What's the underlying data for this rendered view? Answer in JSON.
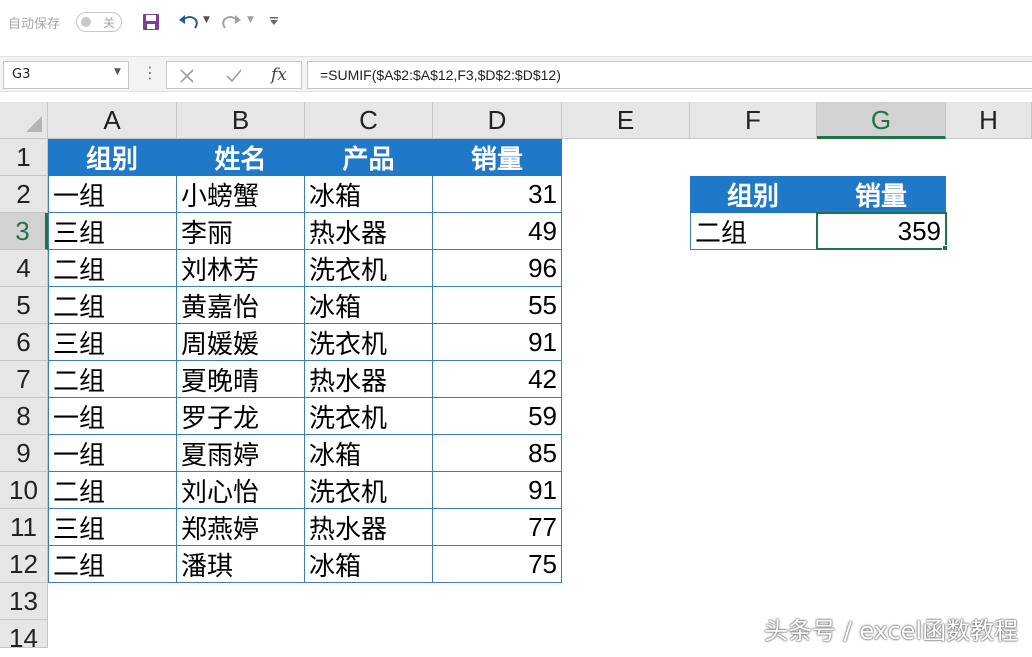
{
  "toolbar": {
    "autosave_label": "自动保存",
    "autosave_state": "关",
    "save_icon": "save-icon",
    "undo_icon": "undo-icon",
    "redo_icon": "redo-icon",
    "customize_icon": "customize-qat-icon"
  },
  "formula_bar": {
    "name_box": "G3",
    "formula": "=SUMIF($A$2:$A$12,F3,$D$2:$D$12)"
  },
  "sheet": {
    "columns": [
      "A",
      "B",
      "C",
      "D",
      "E",
      "F",
      "G",
      "H"
    ],
    "rows": [
      "1",
      "2",
      "3",
      "4",
      "5",
      "6",
      "7",
      "8",
      "9",
      "10",
      "11",
      "12",
      "13",
      "14"
    ],
    "active_cell": "G3",
    "active_column": "G",
    "active_row": "3",
    "table_headers": [
      "组别",
      "姓名",
      "产品",
      "销量"
    ],
    "table_rows": [
      [
        "一组",
        "小螃蟹",
        "冰箱",
        "31"
      ],
      [
        "三组",
        "李丽",
        "热水器",
        "49"
      ],
      [
        "二组",
        "刘林芳",
        "洗衣机",
        "96"
      ],
      [
        "二组",
        "黄嘉怡",
        "冰箱",
        "55"
      ],
      [
        "三组",
        "周媛媛",
        "洗衣机",
        "91"
      ],
      [
        "二组",
        "夏晚晴",
        "热水器",
        "42"
      ],
      [
        "一组",
        "罗子龙",
        "洗衣机",
        "59"
      ],
      [
        "一组",
        "夏雨婷",
        "冰箱",
        "85"
      ],
      [
        "二组",
        "刘心怡",
        "洗衣机",
        "91"
      ],
      [
        "三组",
        "郑燕婷",
        "热水器",
        "77"
      ],
      [
        "二组",
        "潘琪",
        "冰箱",
        "75"
      ]
    ],
    "lookup_headers": [
      "组别",
      "销量"
    ],
    "lookup_row": [
      "二组",
      "359"
    ]
  },
  "watermark": "头条号 / excel函数教程",
  "colors": {
    "header_fill": "#1f78c8",
    "border_blue": "#3d7db8",
    "selection_green": "#217346"
  }
}
